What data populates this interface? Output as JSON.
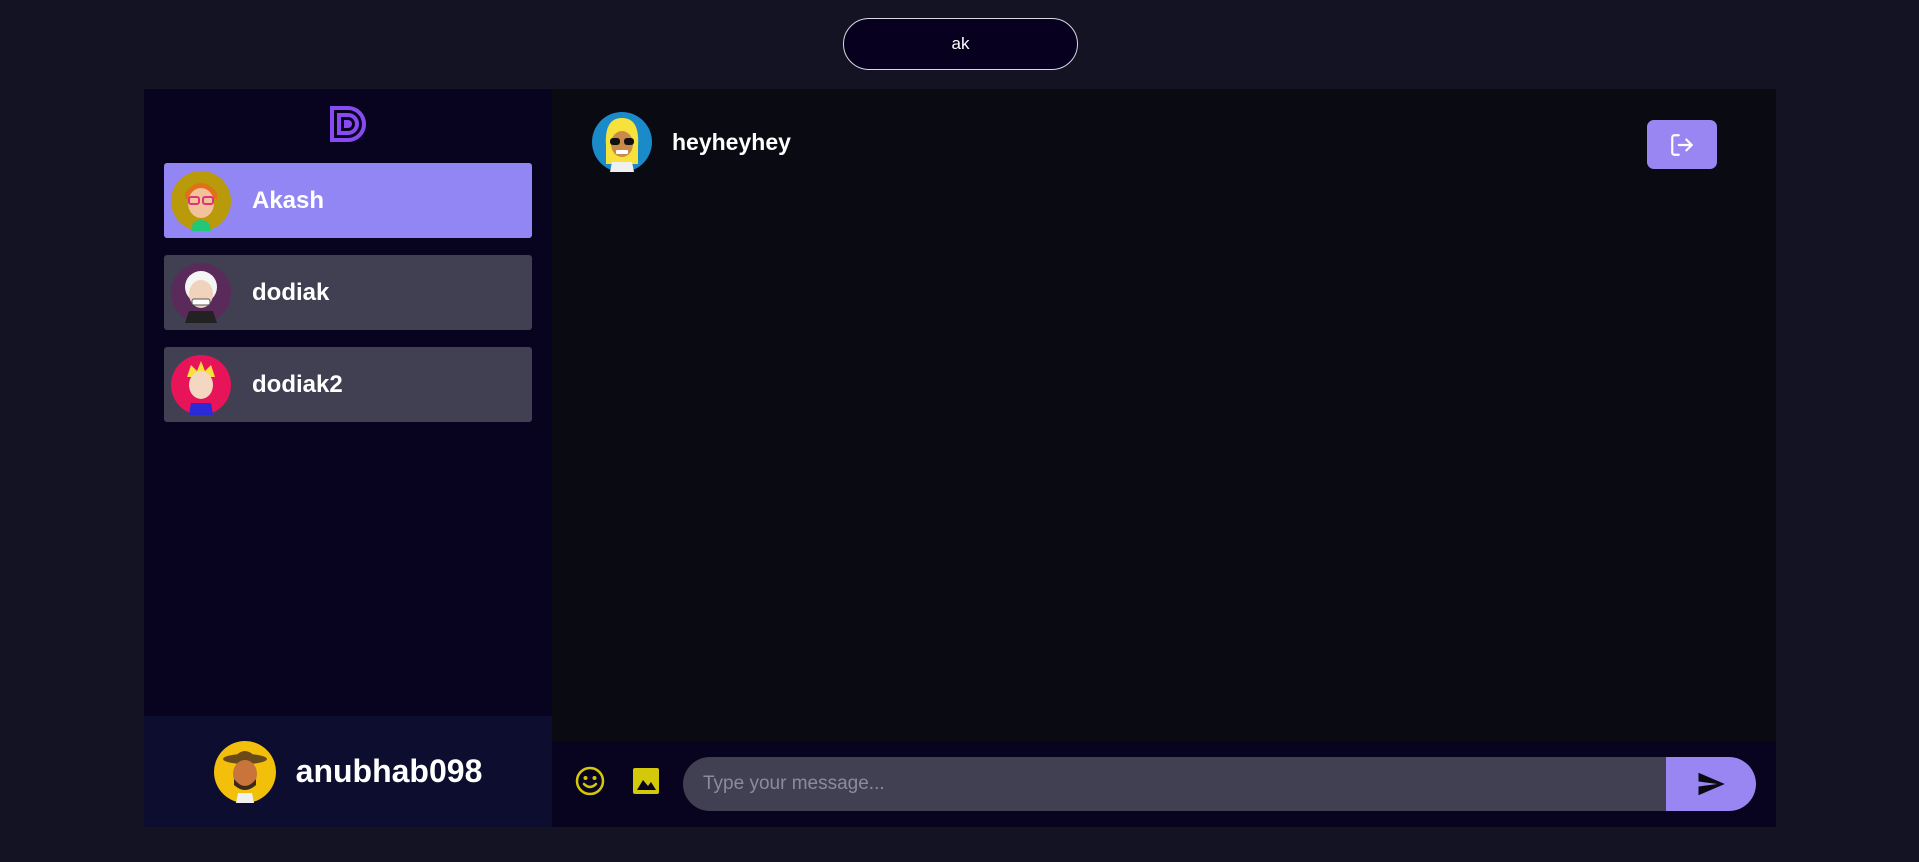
{
  "search": {
    "value": "ak"
  },
  "sidebar": {
    "brand_icon": "logo-icon",
    "contacts": [
      {
        "name": "Akash",
        "selected": true,
        "avatar": "avatar-glasses-orange-hair"
      },
      {
        "name": "dodiak",
        "selected": false,
        "avatar": "avatar-white-hair-grin"
      },
      {
        "name": "dodiak2",
        "selected": false,
        "avatar": "avatar-blonde-pink-bg"
      }
    ],
    "current_user": {
      "name": "anubhab098",
      "avatar": "avatar-cowboy-hat"
    }
  },
  "chat": {
    "header": {
      "name": "heyheyhey",
      "avatar": "avatar-blonde-sunglasses"
    },
    "logout_icon": "logout-icon",
    "input": {
      "placeholder": "Type your message...",
      "value": ""
    },
    "emoji_icon": "emoji-icon",
    "image_icon": "image-icon",
    "send_icon": "send-icon"
  },
  "colors": {
    "page_bg": "#131324",
    "sidebar_bg": "#080420",
    "chat_bg": "#0a0a13",
    "accent": "#9a86f3",
    "contact_bg": "#413f52",
    "icon_yellow": "#d3c80a"
  }
}
